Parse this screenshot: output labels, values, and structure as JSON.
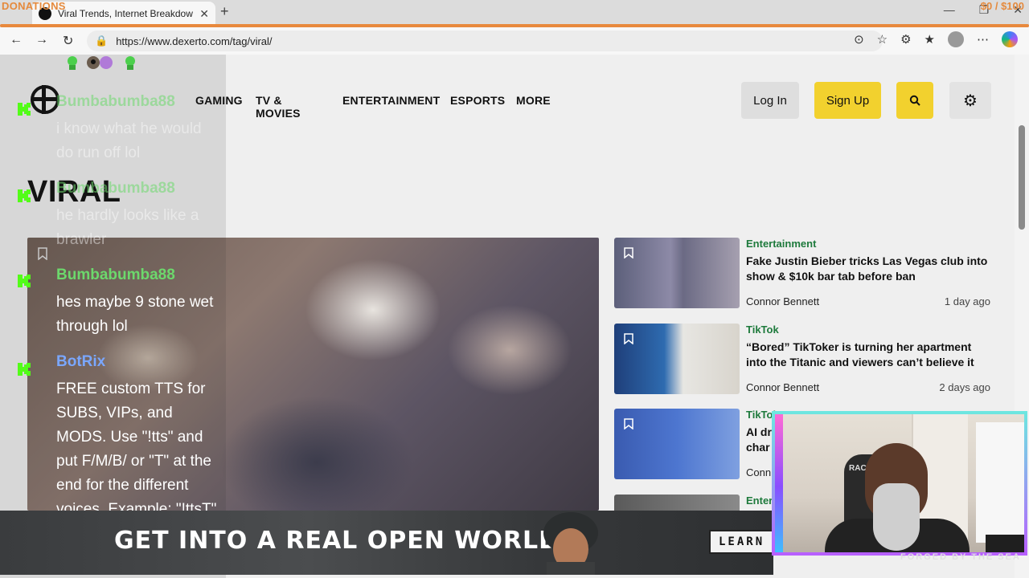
{
  "browser": {
    "tab_title": "Viral Trends, Internet Breakdowns",
    "url": "https://www.dexerto.com/tag/viral/",
    "new_tab_icon": "plus-icon",
    "window_controls": [
      "minimize-icon",
      "restore-icon",
      "close-icon"
    ]
  },
  "stream_overlay": {
    "donations_label": "DONATIONS",
    "donation_goal": "$0 / $100",
    "ad": {
      "headline": "GET INTO A REAL OPEN WORLD",
      "cta_label": "LEARN MORE",
      "tagline": "FORGED BY THE SEA"
    },
    "webcam": {
      "chair_label": "RACER"
    }
  },
  "site": {
    "nav": [
      "GAMING",
      "TV & MOVIES",
      "ENTERTAINMENT",
      "ESPORTS",
      "MORE"
    ],
    "login_label": "Log In",
    "signup_label": "Sign Up",
    "page_heading": "VIRAL",
    "articles": [
      {
        "category": "Entertainment",
        "title": "Fake Justin Bieber tricks Las Vegas club into show & $10k bar tab before ban",
        "author": "Connor Bennett",
        "time": "1 day ago"
      },
      {
        "category": "TikTok",
        "title": "“Bored” TikToker is turning her apartment into the Titanic and viewers can’t believe it",
        "author": "Connor Bennett",
        "time": "2 days ago"
      },
      {
        "category": "TikTok",
        "title": "AI dr",
        "title_line2": "char",
        "author": "Conn",
        "time": ""
      },
      {
        "category": "Enter",
        "title": "",
        "author": "",
        "time": ""
      }
    ]
  },
  "chat": {
    "messages": [
      {
        "user": "Bumbabumba88",
        "text": "i know what he would do run off lol",
        "faded": true
      },
      {
        "user": "Bumbabumba88",
        "text": "he hardly looks like a brawler",
        "faded": true
      },
      {
        "user": "Bumbabumba88",
        "text": "hes maybe 9 stone wet through lol",
        "faded": false
      },
      {
        "user": "BotRix",
        "text": "FREE custom TTS for SUBS, VIPs, and MODS. Use \"!tts\" and put F/M/B/ or \"T\" at the end for the different voices. Example: \"!ttsT\" for the TikTok voice.",
        "faded": false
      }
    ]
  },
  "colors": {
    "accent_orange": "#e8893d",
    "site_yellow": "#f2d12e",
    "category_green": "#1e7a3c",
    "chat_user_green": "#6cd86c",
    "chat_bot_blue": "#7aa7ff"
  }
}
